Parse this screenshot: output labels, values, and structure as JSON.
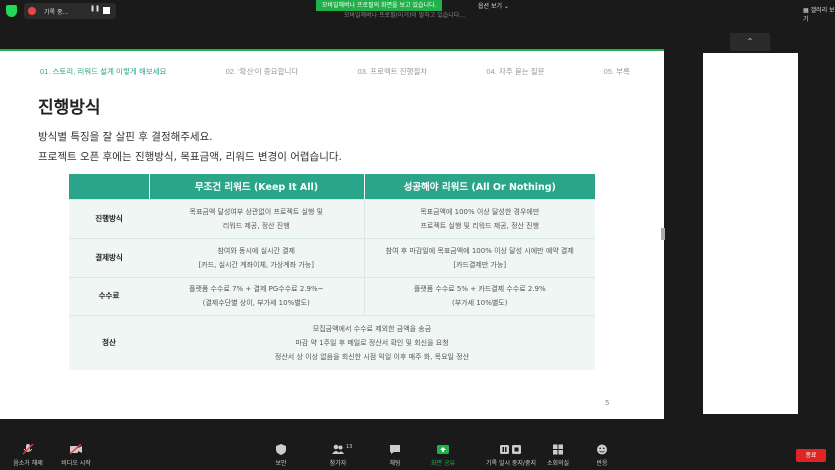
{
  "topbar": {
    "recording_label": "기록 중...",
    "share_banner": "모바일해버나 프로필의 화면을 보고 있습니다.",
    "share_subtitle": "모바일해버나 프로필(이거)이 말하고 있습니다...",
    "share_options": "옵션 보기",
    "gallery_view": "갤러리 보기"
  },
  "slide": {
    "nav": [
      "01. 스토리, 리워드 설계 이렇게 해보세요",
      "02. '확산'이 중요합니다",
      "03. 프로젝트 진행절차",
      "04. 자주 묻는 질문",
      "05. 부록"
    ],
    "title": "진행방식",
    "desc_line1": "방식별 특징을 잘 살핀 후 결정해주세요.",
    "desc_line2": "프로젝트 오픈 후에는 진행방식, 목표금액, 리워드 변경이 어렵습니다.",
    "table": {
      "header_col1": "무조건 리워드 (Keep It All)",
      "header_col2": "성공해야 리워드 (All Or Nothing)",
      "rows": [
        {
          "label": "진행방식",
          "col1": [
            "목표금액 달성여부 상관없이 프로젝트 실행 및",
            "리워드 제공, 정산 진행"
          ],
          "col2": [
            "목표금액에 100% 이상 달성한 경우에만",
            "프로젝트 실행 및 리워드 제공, 정산 진행"
          ]
        },
        {
          "label": "결제방식",
          "col1": [
            "참여와 동시에 실시간 결제",
            "[카드, 실시간 계좌이체, 가상계좌 가능]"
          ],
          "col2": [
            "참여 후 마감일에 목표금액에 100% 이상 달성 시에만 예약 결제",
            "[카드결제만 가능]"
          ]
        },
        {
          "label": "수수료",
          "col1": [
            "플랫폼 수수료 7% + 결제 PG수수료 2.9%~",
            "(결제수단별 상이, 부가세 10%별도)"
          ],
          "col2": [
            "플랫폼 수수료 5% + 카드결제 수수료 2.9%",
            "(부가세 10%별도)"
          ]
        },
        {
          "label": "정산",
          "merged": [
            "모집금액에서 수수료 제외한 금액을 송금",
            "마감 약 1주일 후 메일로 정산서 확인 및 회신을 요청",
            "정산서 상 이상 없음을 회신한 시점 익일 이후 매주 화, 목요일 정산"
          ]
        }
      ]
    },
    "page_number": "5"
  },
  "toolbar": {
    "mute": "음소거 해제",
    "video": "비디오 시작",
    "security": "보안",
    "participants": "참가자",
    "participants_count": "13",
    "chat": "채팅",
    "share_screen": "화면 공유",
    "pause_recording": "기록 일시 중지/중지",
    "breakout": "소회의실",
    "reactions": "반응",
    "end": "종료"
  },
  "colors": {
    "accent": "#2ba58a",
    "zoom_green": "#22b04b",
    "end_red": "#e02424"
  }
}
